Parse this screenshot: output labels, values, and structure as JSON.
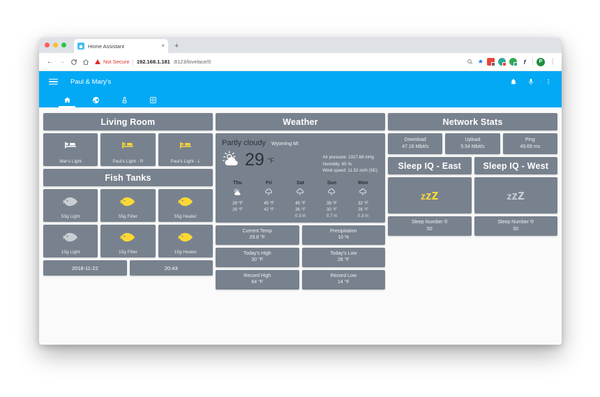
{
  "browser": {
    "tab_title": "Home Assistant",
    "tab_close": "×",
    "new_tab": "+",
    "back": "←",
    "forward": "→",
    "reload": "C",
    "home": "⌂",
    "security_label": "Not Secure",
    "url_host": "192.168.1.181",
    "url_path": ":8123/lovelace/0",
    "zoom_icon": "search-icon",
    "bookmark_icon": "star-icon",
    "profile_initial": "P",
    "menu_icon": "⋮"
  },
  "app": {
    "title": "Paul & Mary's",
    "menu_icon": "hamburger-icon",
    "actions": [
      "bell-icon",
      "microphone-icon",
      "overflow-menu-icon"
    ],
    "tabs": [
      {
        "name": "home-tab",
        "icon": "home-icon",
        "active": true
      },
      {
        "name": "globe-tab",
        "icon": "globe-icon",
        "active": false
      },
      {
        "name": "fishtank-tab",
        "icon": "fish-tank-icon",
        "active": false
      },
      {
        "name": "camera-tab",
        "icon": "camera-icon",
        "active": false
      }
    ]
  },
  "colors": {
    "accent": "#03a9f4",
    "tile": "#78828e",
    "icon_on": "#fdd835",
    "icon_off": "#ffffff",
    "icon_dim": "#c9ced4",
    "page_bg": "#fafafa"
  },
  "living_room": {
    "header": "Living Room",
    "lights": [
      {
        "label": "Mar's Light",
        "icon": "bed-icon",
        "state": "off"
      },
      {
        "label": "Paul's Light - R",
        "icon": "bed-icon",
        "state": "on"
      },
      {
        "label": "Paul's Light - L",
        "icon": "bed-icon",
        "state": "on"
      }
    ]
  },
  "fish_tanks": {
    "header": "Fish Tanks",
    "row1": [
      {
        "label": "55g Light",
        "icon": "fish-icon",
        "state": "off"
      },
      {
        "label": "55g Filter",
        "icon": "fish-icon",
        "state": "on"
      },
      {
        "label": "55g Heater",
        "icon": "fish-icon",
        "state": "on"
      }
    ],
    "row2": [
      {
        "label": "15g Light",
        "icon": "fish-icon",
        "state": "off"
      },
      {
        "label": "15g Filter",
        "icon": "fish-icon",
        "state": "on"
      },
      {
        "label": "15g Heater",
        "icon": "fish-icon",
        "state": "on"
      }
    ],
    "date": "2018-11-22",
    "time": "20:43"
  },
  "weather": {
    "header": "Weather",
    "condition": "Partly cloudy",
    "location": "Wyoming MI",
    "temp": "29",
    "unit": "°F",
    "icon": "partly-cloudy-icon",
    "details": [
      "Air pressure: 1027.68 inHg",
      "Humidity: 65 %",
      "Wind speed: 11.52 mi/h (SE)"
    ],
    "forecast": [
      {
        "day": "Thu",
        "icon": "partly-cloudy-icon",
        "high": "29 °F",
        "low": "28 °F",
        "precip": ""
      },
      {
        "day": "Fri",
        "icon": "rainy-icon",
        "high": "45 °F",
        "low": "42 °F",
        "precip": ""
      },
      {
        "day": "Sat",
        "icon": "rainy-icon",
        "high": "45 °F",
        "low": "36 °F",
        "precip": "0.3 in"
      },
      {
        "day": "Sun",
        "icon": "rainy-icon",
        "high": "39 °F",
        "low": "30 °F",
        "precip": "0.7 in"
      },
      {
        "day": "Mon",
        "icon": "rainy-icon",
        "high": "32 °F",
        "low": "26 °F",
        "precip": "0.3 in"
      }
    ],
    "stats": [
      {
        "name": "Current Temp",
        "value": "29.8 °F"
      },
      {
        "name": "Precipitation",
        "value": "10 %"
      },
      {
        "name": "Today's High",
        "value": "30 °F"
      },
      {
        "name": "Today's Low",
        "value": "28 °F"
      },
      {
        "name": "Record High",
        "value": "64 °F"
      },
      {
        "name": "Record Low",
        "value": "14 °F"
      }
    ]
  },
  "network": {
    "header": "Network Stats",
    "stats": [
      {
        "name": "Download",
        "value": "47.16 Mbit/s"
      },
      {
        "name": "Upload",
        "value": "5.54 Mbit/s"
      },
      {
        "name": "Ping",
        "value": "49.69 ms"
      }
    ]
  },
  "sleep": {
    "east": {
      "header": "Sleep IQ - East",
      "icon": "sleep-zzz-icon",
      "state": "on",
      "number_label": "Sleep Number ®",
      "number_value": "50"
    },
    "west": {
      "header": "Sleep IQ - West",
      "icon": "sleep-zzz-icon",
      "state": "off",
      "number_label": "Sleep Number ®",
      "number_value": "50"
    }
  }
}
